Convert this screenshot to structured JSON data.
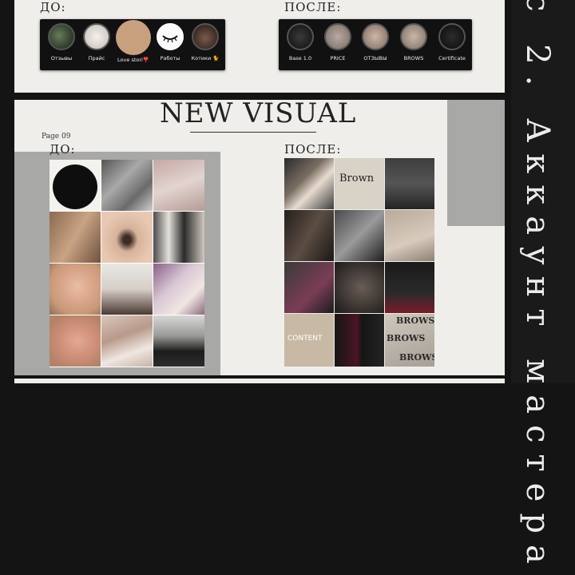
{
  "top": {
    "before_label": "ДО:",
    "after_label": "ПОСЛЕ:",
    "before_highlights": [
      "Отзывы",
      "Прайс",
      "Love stori❣️",
      "Работы",
      "Котики 🐈"
    ],
    "after_highlights": [
      "Base 1.0",
      "PRICE",
      "ОТЗЫВЫ",
      "BROWS",
      "Certificate"
    ]
  },
  "main": {
    "title": "NEW VISUAL",
    "page": "Page 09",
    "before_label": "ДО:",
    "after_label": "ПОСЛЕ:",
    "after_tiles": {
      "brown": "Brown",
      "content": "CONTENT",
      "brows_1": "BROWS",
      "brows_2": "BROWS",
      "brows_3": "BROWS"
    }
  },
  "side": {
    "text": "с 2. Аккаунт мастера"
  },
  "colors": {
    "panel": "#efeeeb",
    "background": "#141414",
    "gray_block": "#a8a8a6",
    "skin_circle": "#c9a07e"
  }
}
